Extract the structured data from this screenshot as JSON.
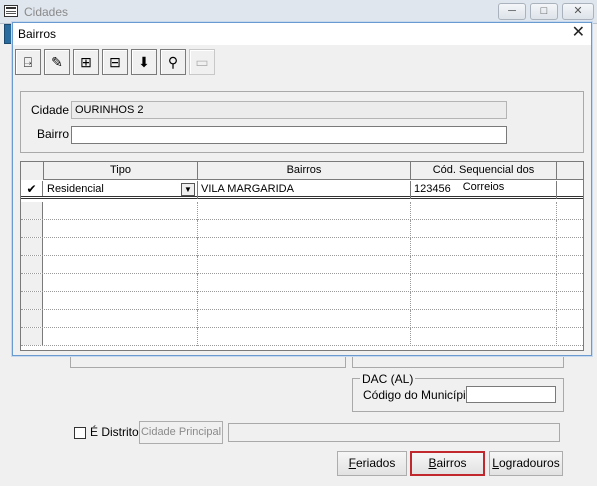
{
  "parent_window": {
    "title": "Cidades",
    "window_buttons": [
      "─",
      "□",
      "✕"
    ]
  },
  "dialog": {
    "title": "Bairros",
    "close_glyph": "✕",
    "toolbar": [
      {
        "name": "exit-icon",
        "glyph": "⍈"
      },
      {
        "name": "edit-icon",
        "glyph": "✎"
      },
      {
        "name": "insert-icon",
        "glyph": "⊞"
      },
      {
        "name": "delete-icon",
        "glyph": "⊟"
      },
      {
        "name": "save-icon",
        "glyph": "⬇"
      },
      {
        "name": "search-binoculars-icon",
        "glyph": "⚲"
      },
      {
        "name": "blank-disabled-icon",
        "glyph": "▭"
      }
    ],
    "form": {
      "cidade_label": "Cidade",
      "cidade_value": "OURINHOS 2",
      "bairro_label": "Bairro",
      "bairro_value": ""
    },
    "grid": {
      "columns": [
        "Tipo",
        "Bairros",
        "Cód. Sequencial dos Correios"
      ],
      "rows": [
        {
          "indicator": "✔",
          "tipo": "Residencial",
          "bairro": "VILA MARGARIDA",
          "cod": "123456"
        }
      ],
      "empty_rows": 8
    }
  },
  "dac_group": {
    "legend": "DAC (AL)",
    "codigo_label": "Código do Município",
    "codigo_value": ""
  },
  "distrito": {
    "label": "É Distrito",
    "checked": false,
    "cidade_principal_button": "Cidade Principal",
    "cidade_principal_value": ""
  },
  "bottom_buttons": [
    {
      "label": "Feriados",
      "focused": false
    },
    {
      "label": "Bairros",
      "focused": true
    },
    {
      "label": "Logradouros",
      "focused": false
    }
  ],
  "colors": {
    "focus_border": "#c1282d",
    "dialog_border": "#6a9bd0"
  }
}
